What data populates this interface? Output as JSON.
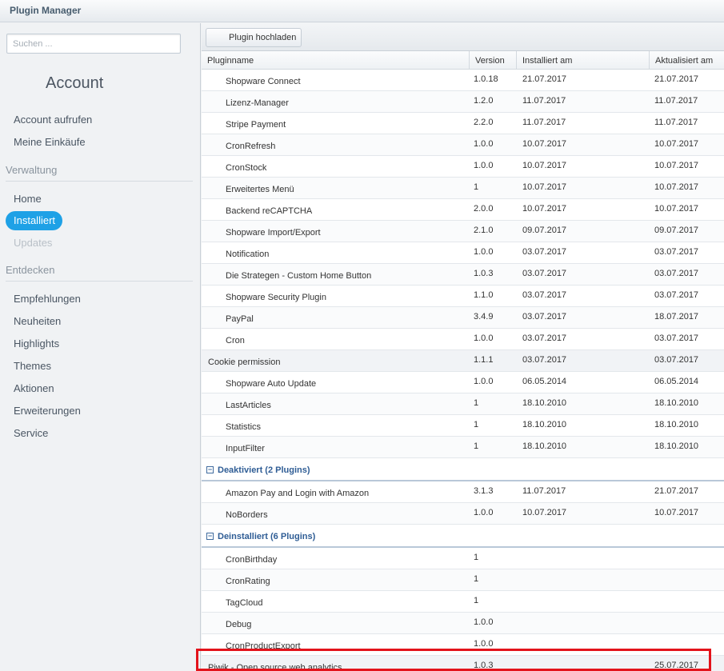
{
  "window": {
    "title": "Plugin Manager"
  },
  "sidebar": {
    "search_placeholder": "Suchen ...",
    "account_title": "Account",
    "account_items": [
      "Account aufrufen",
      "Meine Einkäufe"
    ],
    "verwaltung_label": "Verwaltung",
    "verwaltung_items": {
      "home": "Home",
      "installiert": "Installiert",
      "updates": "Updates"
    },
    "entdecken_label": "Entdecken",
    "entdecken_items": [
      "Empfehlungen",
      "Neuheiten",
      "Highlights",
      "Themes",
      "Aktionen",
      "Erweiterungen",
      "Service"
    ]
  },
  "toolbar": {
    "upload_label": "Plugin hochladen"
  },
  "grid": {
    "columns": {
      "name": "Pluginname",
      "version": "Version",
      "installed": "Installiert am",
      "updated": "Aktualisiert am"
    },
    "installed_rows": [
      {
        "name": "Shopware Connect",
        "version": "1.0.18",
        "installed": "21.07.2017",
        "updated": "21.07.2017"
      },
      {
        "name": "Lizenz-Manager",
        "version": "1.2.0",
        "installed": "11.07.2017",
        "updated": "11.07.2017"
      },
      {
        "name": "Stripe Payment",
        "version": "2.2.0",
        "installed": "11.07.2017",
        "updated": "11.07.2017"
      },
      {
        "name": "CronRefresh",
        "version": "1.0.0",
        "installed": "10.07.2017",
        "updated": "10.07.2017"
      },
      {
        "name": "CronStock",
        "version": "1.0.0",
        "installed": "10.07.2017",
        "updated": "10.07.2017"
      },
      {
        "name": "Erweitertes Menü",
        "version": "1",
        "installed": "10.07.2017",
        "updated": "10.07.2017"
      },
      {
        "name": "Backend reCAPTCHA",
        "version": "2.0.0",
        "installed": "10.07.2017",
        "updated": "10.07.2017"
      },
      {
        "name": "Shopware Import/Export",
        "version": "2.1.0",
        "installed": "09.07.2017",
        "updated": "09.07.2017"
      },
      {
        "name": "Notification",
        "version": "1.0.0",
        "installed": "03.07.2017",
        "updated": "03.07.2017"
      },
      {
        "name": "Die Strategen - Custom Home Button",
        "version": "1.0.3",
        "installed": "03.07.2017",
        "updated": "03.07.2017"
      },
      {
        "name": "Shopware Security Plugin",
        "version": "1.1.0",
        "installed": "03.07.2017",
        "updated": "03.07.2017"
      },
      {
        "name": "PayPal",
        "version": "3.4.9",
        "installed": "03.07.2017",
        "updated": "18.07.2017"
      },
      {
        "name": "Cron",
        "version": "1.0.0",
        "installed": "03.07.2017",
        "updated": "03.07.2017"
      },
      {
        "name": "Cookie permission",
        "version": "1.1.1",
        "installed": "03.07.2017",
        "updated": "03.07.2017"
      },
      {
        "name": "Shopware Auto Update",
        "version": "1.0.0",
        "installed": "06.05.2014",
        "updated": "06.05.2014"
      },
      {
        "name": "LastArticles",
        "version": "1",
        "installed": "18.10.2010",
        "updated": "18.10.2010"
      },
      {
        "name": "Statistics",
        "version": "1",
        "installed": "18.10.2010",
        "updated": "18.10.2010"
      },
      {
        "name": "InputFilter",
        "version": "1",
        "installed": "18.10.2010",
        "updated": "18.10.2010"
      }
    ],
    "group_deactivated": {
      "toggle": "−",
      "label": "Deaktiviert (2 Plugins)"
    },
    "deactivated_rows": [
      {
        "name": "Amazon Pay and Login with Amazon",
        "version": "3.1.3",
        "installed": "11.07.2017",
        "updated": "21.07.2017"
      },
      {
        "name": "NoBorders",
        "version": "1.0.0",
        "installed": "10.07.2017",
        "updated": "10.07.2017"
      }
    ],
    "group_uninstalled": {
      "toggle": "−",
      "label": "Deinstalliert (6 Plugins)"
    },
    "uninstalled_rows": [
      {
        "name": "CronBirthday",
        "version": "1",
        "installed": "",
        "updated": ""
      },
      {
        "name": "CronRating",
        "version": "1",
        "installed": "",
        "updated": ""
      },
      {
        "name": "TagCloud",
        "version": "1",
        "installed": "",
        "updated": ""
      },
      {
        "name": "Debug",
        "version": "1.0.0",
        "installed": "",
        "updated": ""
      },
      {
        "name": "CronProductExport",
        "version": "1.0.0",
        "installed": "",
        "updated": ""
      },
      {
        "name": "Piwik - Open source web analytics",
        "version": "1.0.3",
        "installed": "",
        "updated": "25.07.2017"
      }
    ]
  },
  "colors": {
    "accent": "#1ea1e6",
    "group_text": "#2f5d95",
    "highlight": "#e3131b"
  }
}
